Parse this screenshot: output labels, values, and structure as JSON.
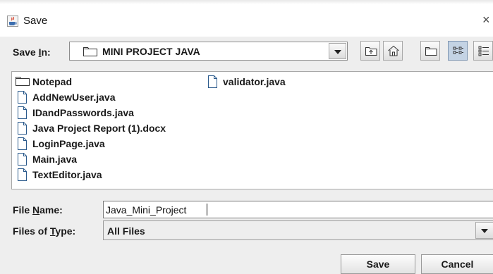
{
  "window": {
    "title": "Save",
    "close_glyph": "×"
  },
  "save_in": {
    "label_pre": "Save ",
    "label_mnemonic": "I",
    "label_post": "n:",
    "selected_folder": "MINI PROJECT JAVA"
  },
  "toolbar": {
    "buttons": [
      {
        "name": "up-one-level-icon"
      },
      {
        "name": "home-icon"
      },
      {
        "name": "new-folder-icon"
      },
      {
        "name": "list-view-icon",
        "active": true
      },
      {
        "name": "details-view-icon"
      }
    ]
  },
  "files": [
    {
      "name": "Notepad",
      "type": "folder"
    },
    {
      "name": "AddNewUser.java",
      "type": "file"
    },
    {
      "name": "IDandPasswords.java",
      "type": "file"
    },
    {
      "name": "Java Project Report (1).docx",
      "type": "file"
    },
    {
      "name": "LoginPage.java",
      "type": "file"
    },
    {
      "name": "Main.java",
      "type": "file"
    },
    {
      "name": "TextEditor.java",
      "type": "file"
    },
    {
      "name": "validator.java",
      "type": "file"
    }
  ],
  "file_name": {
    "label_pre": "File ",
    "label_mnemonic": "N",
    "label_post": "ame:",
    "value": "Java_Mini_Project"
  },
  "file_type": {
    "label_pre": "Files of ",
    "label_mnemonic": "T",
    "label_post": "ype:",
    "selected": "All Files"
  },
  "buttons": {
    "save": "Save",
    "cancel": "Cancel"
  },
  "colors": {
    "dialog_bg": "#eeeeee",
    "active_view_button": "#c4d3e4"
  }
}
